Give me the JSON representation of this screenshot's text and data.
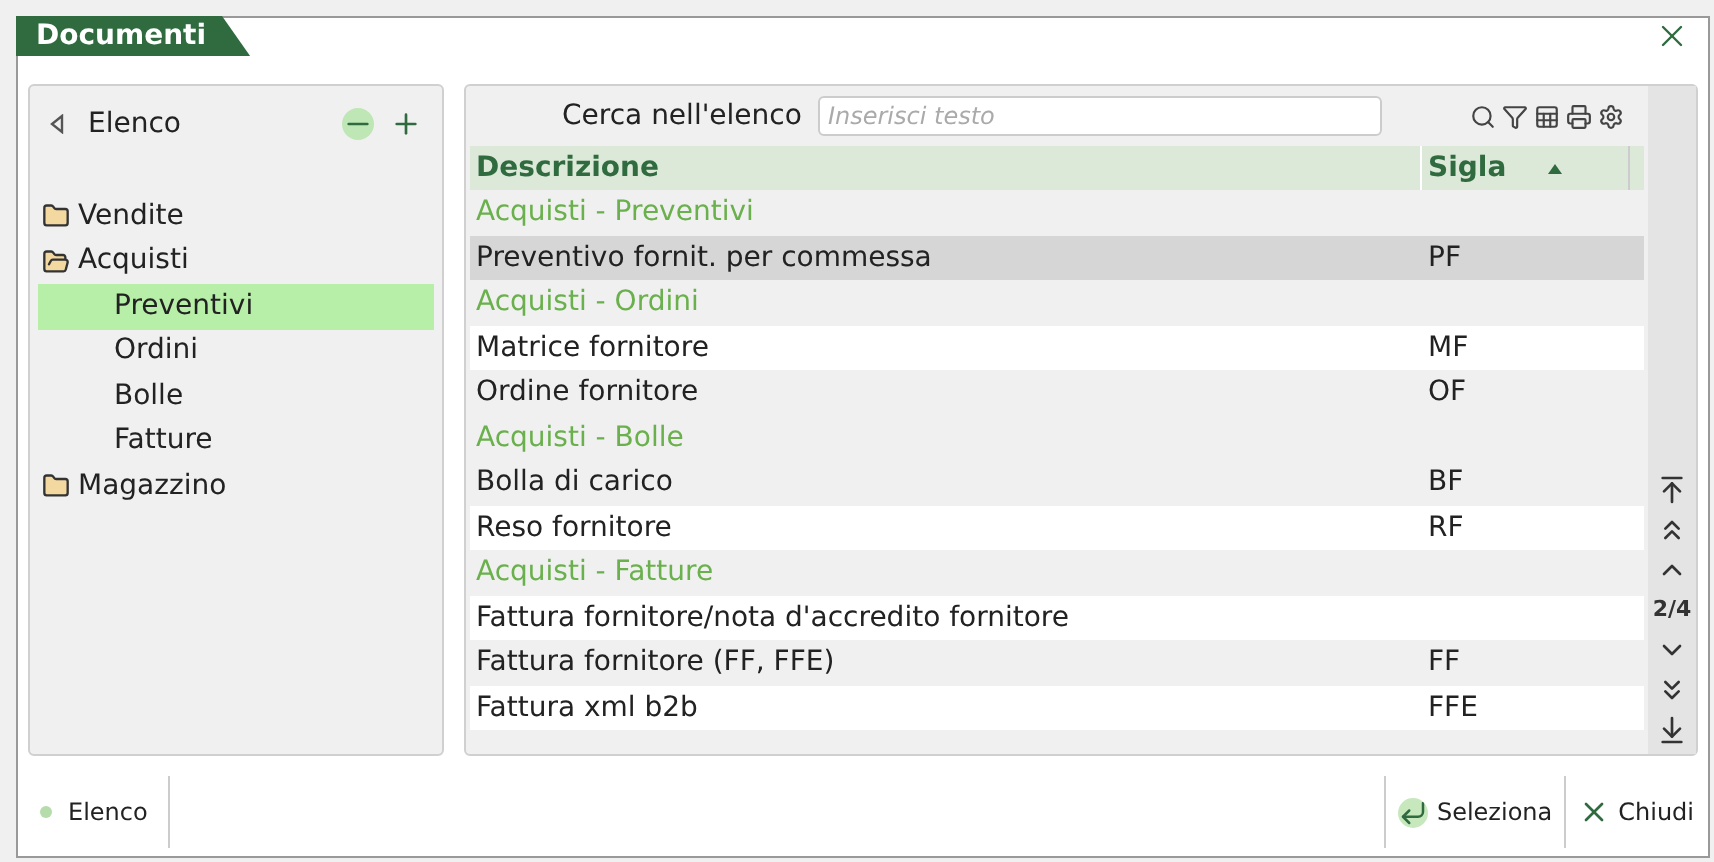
{
  "window": {
    "title": "Documenti"
  },
  "sidebar": {
    "title": "Elenco",
    "items": [
      {
        "label": "Vendite",
        "expanded": false,
        "selected": false
      },
      {
        "label": "Acquisti",
        "expanded": true,
        "selected": false,
        "children": [
          {
            "label": "Preventivi",
            "selected": true
          },
          {
            "label": "Ordini",
            "selected": false
          },
          {
            "label": "Bolle",
            "selected": false
          },
          {
            "label": "Fatture",
            "selected": false
          }
        ]
      },
      {
        "label": "Magazzino",
        "expanded": false,
        "selected": false
      }
    ]
  },
  "search": {
    "label": "Cerca nell'elenco",
    "placeholder": "Inserisci testo"
  },
  "table": {
    "columns": [
      "Descrizione",
      "Sigla"
    ],
    "rows": [
      {
        "kind": "group",
        "descrizione": "Acquisti - Preventivi"
      },
      {
        "kind": "row",
        "descrizione": "Preventivo fornit. per commessa",
        "sigla": "PF",
        "selected": true
      },
      {
        "kind": "group",
        "descrizione": "Acquisti - Ordini"
      },
      {
        "kind": "row",
        "descrizione": "Matrice fornitore",
        "sigla": "MF",
        "selected": false
      },
      {
        "kind": "row",
        "descrizione": "Ordine fornitore",
        "sigla": "OF",
        "selected": false
      },
      {
        "kind": "group",
        "descrizione": "Acquisti - Bolle"
      },
      {
        "kind": "row",
        "descrizione": "Bolla di carico",
        "sigla": "BF",
        "selected": false
      },
      {
        "kind": "row",
        "descrizione": "Reso fornitore",
        "sigla": "RF",
        "selected": false
      },
      {
        "kind": "group",
        "descrizione": "Acquisti - Fatture"
      },
      {
        "kind": "row",
        "descrizione": "Fattura fornitore/nota d'accredito fornitore",
        "selected": false
      },
      {
        "kind": "row",
        "descrizione": "Fattura fornitore (FF, FFE)",
        "sigla": "FF",
        "selected": false
      },
      {
        "kind": "row",
        "descrizione": "Fattura xml b2b",
        "sigla": "FFE",
        "selected": false
      }
    ]
  },
  "pager": "2/4",
  "status_bar": {
    "label": "Elenco",
    "buttons": [
      "Seleziona",
      "Chiudi"
    ]
  }
}
